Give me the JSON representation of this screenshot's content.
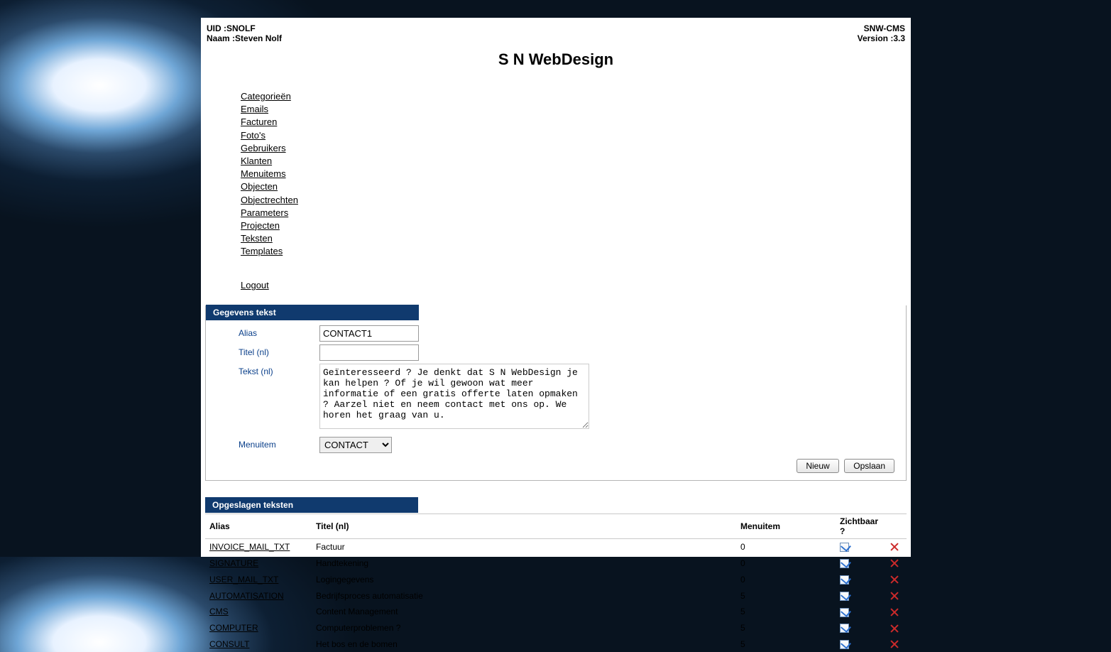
{
  "header": {
    "uid_label": "UID :",
    "uid_value": "SNOLF",
    "name_label": "Naam :",
    "name_value": "Steven Nolf",
    "brand": "S N WebDesign",
    "app_name": "SNW-CMS",
    "version_label": "Version :",
    "version_value": "3.3"
  },
  "nav": {
    "items": [
      "Categorieën",
      "Emails",
      "Facturen",
      "Foto's",
      "Gebruikers",
      "Klanten",
      "Menuitems",
      "Objecten",
      "Objectrechten",
      "Parameters",
      "Projecten",
      "Teksten",
      "Templates"
    ],
    "logout": "Logout"
  },
  "form": {
    "panel_title": "Gegevens tekst",
    "alias_label": "Alias",
    "alias_value": "CONTACT1",
    "titel_label": "Titel (nl)",
    "titel_value": "",
    "tekst_label": "Tekst (nl)",
    "tekst_value": "Geïnteresseerd ? Je denkt dat S N WebDesign je kan helpen ? Of je wil gewoon wat meer informatie of een gratis offerte laten opmaken ? Aarzel niet en neem contact met ons op. We horen het graag van u.",
    "menuitem_label": "Menuitem",
    "menuitem_selected": "CONTACT",
    "btn_new": "Nieuw",
    "btn_save": "Opslaan"
  },
  "list": {
    "panel_title": "Opgeslagen teksten",
    "columns": {
      "alias": "Alias",
      "titel": "Titel (nl)",
      "menuitem": "Menuitem",
      "visible": "Zichtbaar ?"
    },
    "rows": [
      {
        "alias": "INVOICE_MAIL_TXT",
        "titel": "Factuur",
        "menuitem": "0",
        "visible": true
      },
      {
        "alias": "SIGNATURE",
        "titel": "Handtekening",
        "menuitem": "0",
        "visible": true
      },
      {
        "alias": "USER_MAIL_TXT",
        "titel": "Logingegevens",
        "menuitem": "0",
        "visible": true
      },
      {
        "alias": "AUTOMATISATION",
        "titel": "Bedrijfsproces automatisatie",
        "menuitem": "5",
        "visible": true
      },
      {
        "alias": "CMS",
        "titel": "Content Management",
        "menuitem": "5",
        "visible": true
      },
      {
        "alias": "COMPUTER",
        "titel": "Computerproblemen ?",
        "menuitem": "5",
        "visible": true
      },
      {
        "alias": "CONSULT",
        "titel": "Het bos en de bomen",
        "menuitem": "5",
        "visible": true
      }
    ]
  }
}
